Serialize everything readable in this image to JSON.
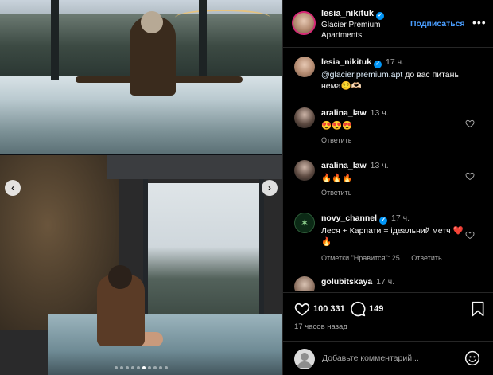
{
  "post": {
    "username": "lesia_nikituk",
    "location": "Glacier Premium Apartments",
    "follow_label": "Подписаться",
    "more_label": "•••"
  },
  "carousel": {
    "prev_label": "‹",
    "next_label": "›",
    "slide_count": 10,
    "active_slide": 5
  },
  "comments": [
    {
      "user": "lesia_nikituk",
      "verified": true,
      "time": "17 ч.",
      "mention": "@glacier.premium.apt",
      "text": "до вас питань нема😌🫶🏻"
    },
    {
      "user": "aralina_law",
      "time": "13 ч.",
      "text": "😍😍😍",
      "reply_label": "Ответить"
    },
    {
      "user": "aralina_law",
      "time": "13 ч.",
      "text": "🔥🔥🔥",
      "reply_label": "Ответить"
    },
    {
      "user": "novy_channel",
      "verified": true,
      "time": "17 ч.",
      "text": "Леся + Карпати = ідеальний метч ❤️🔥",
      "likes_label": "Отметки \"Нравится\": 25",
      "reply_label": "Ответить"
    },
    {
      "user": "golubitskaya",
      "time": "17 ч."
    }
  ],
  "actions": {
    "likes": "100 331",
    "comments": "149",
    "posted": "17 часов назад"
  },
  "composer": {
    "placeholder": "Добавьте комментарий..."
  },
  "colors": {
    "accent": "#4a9eff",
    "verified": "#0095f6",
    "muted": "#a8a8a8",
    "background": "#000000"
  }
}
